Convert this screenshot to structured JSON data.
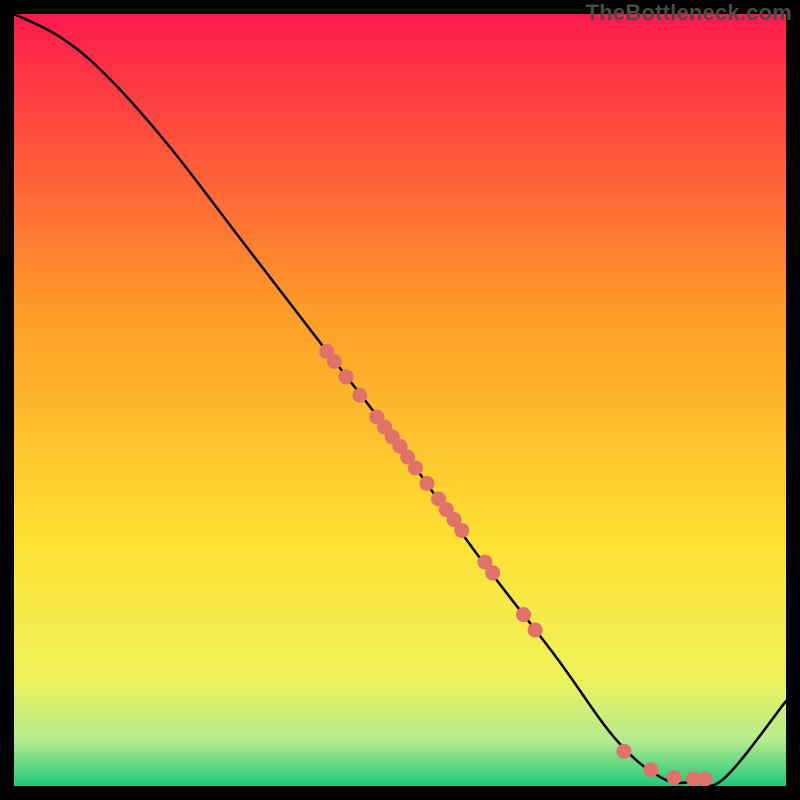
{
  "watermark": "TheBottleneck.com",
  "colors": {
    "top": "#ff1a4d",
    "mid_orange": "#ff9a28",
    "mid_yellow": "#ffe033",
    "low_yellow": "#eef25a",
    "pale_green": "#b5eb8d",
    "green": "#1fc97a",
    "curve": "#000000",
    "dot": "#e0726a",
    "dot_stroke": "#b24a45",
    "bg": "#000000"
  },
  "chart_data": {
    "type": "line",
    "title": "",
    "xlabel": "",
    "ylabel": "",
    "x_range": [
      0,
      100
    ],
    "y_range": [
      0,
      100
    ],
    "curve": [
      {
        "x": 0,
        "y": 100
      },
      {
        "x": 6,
        "y": 97
      },
      {
        "x": 12,
        "y": 92
      },
      {
        "x": 20,
        "y": 83
      },
      {
        "x": 30,
        "y": 70
      },
      {
        "x": 40,
        "y": 57
      },
      {
        "x": 50,
        "y": 44
      },
      {
        "x": 60,
        "y": 30
      },
      {
        "x": 70,
        "y": 17
      },
      {
        "x": 78,
        "y": 6
      },
      {
        "x": 84,
        "y": 1
      },
      {
        "x": 88,
        "y": 0.5
      },
      {
        "x": 92,
        "y": 1
      },
      {
        "x": 100,
        "y": 11
      }
    ],
    "dots": [
      {
        "x": 40.5,
        "y": 56.3
      },
      {
        "x": 41.5,
        "y": 55.0
      },
      {
        "x": 43.0,
        "y": 53.0
      },
      {
        "x": 44.8,
        "y": 50.6
      },
      {
        "x": 47.0,
        "y": 47.8
      },
      {
        "x": 48.0,
        "y": 46.5
      },
      {
        "x": 49.0,
        "y": 45.2
      },
      {
        "x": 50.0,
        "y": 44.0
      },
      {
        "x": 51.0,
        "y": 42.6
      },
      {
        "x": 52.0,
        "y": 41.2
      },
      {
        "x": 53.5,
        "y": 39.2
      },
      {
        "x": 55.0,
        "y": 37.2
      },
      {
        "x": 56.0,
        "y": 35.8
      },
      {
        "x": 57.0,
        "y": 34.5
      },
      {
        "x": 58.0,
        "y": 33.1
      },
      {
        "x": 61.0,
        "y": 29.0
      },
      {
        "x": 62.0,
        "y": 27.6
      },
      {
        "x": 66.0,
        "y": 22.2
      },
      {
        "x": 67.5,
        "y": 20.2
      },
      {
        "x": 79.0,
        "y": 4.5
      },
      {
        "x": 82.5,
        "y": 2.1
      },
      {
        "x": 85.5,
        "y": 1.1
      },
      {
        "x": 88.0,
        "y": 0.9
      },
      {
        "x": 89.5,
        "y": 0.9
      }
    ]
  }
}
